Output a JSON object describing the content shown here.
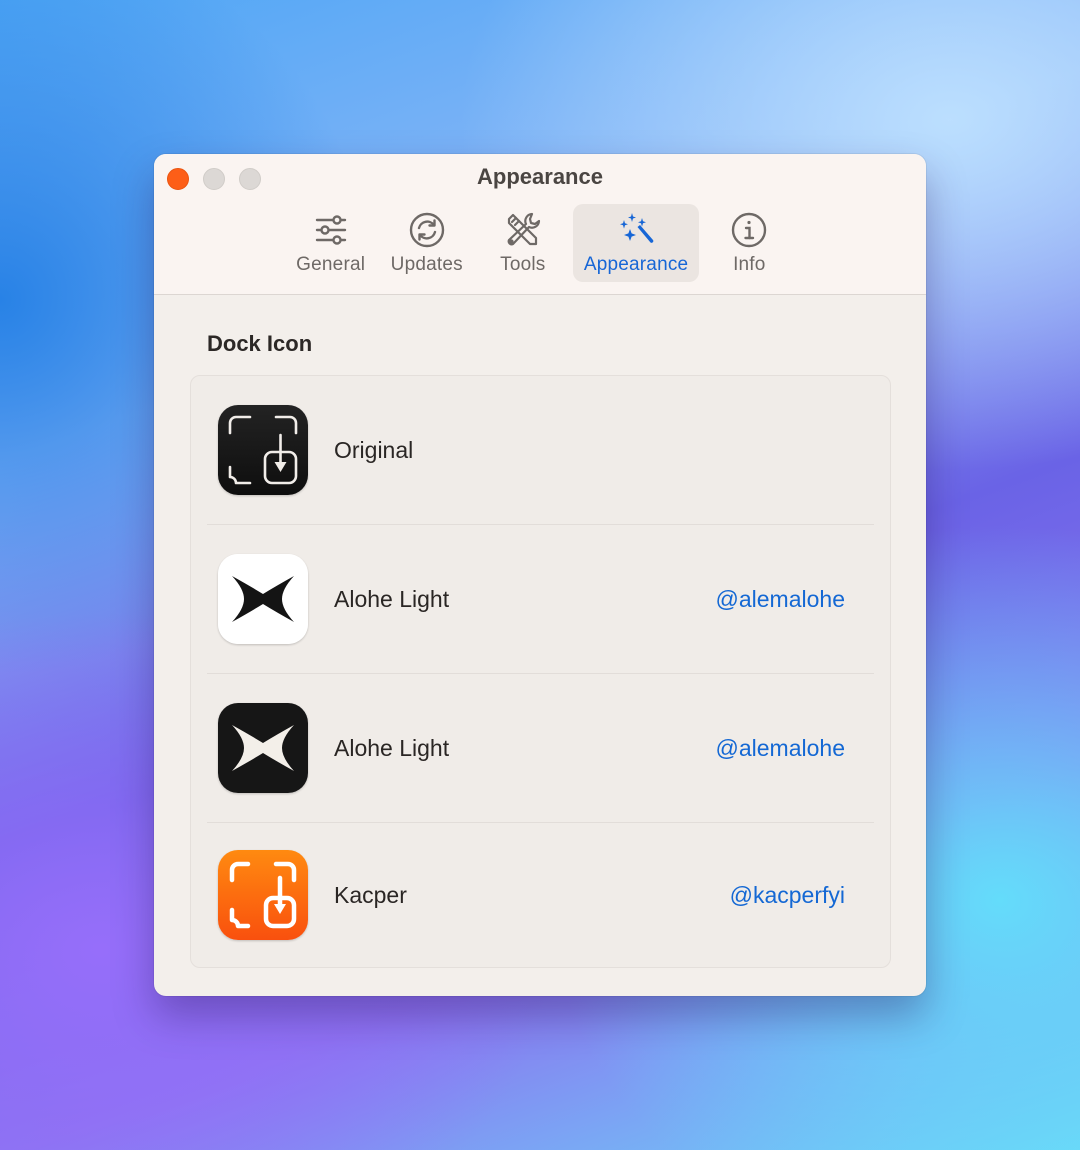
{
  "window": {
    "title": "Appearance",
    "traffic_lights": [
      "close",
      "minimize",
      "zoom"
    ]
  },
  "toolbar": {
    "tabs": [
      {
        "label": "General",
        "icon": "sliders-icon",
        "active": false
      },
      {
        "label": "Updates",
        "icon": "refresh-icon",
        "active": false
      },
      {
        "label": "Tools",
        "icon": "tools-icon",
        "active": false
      },
      {
        "label": "Appearance",
        "icon": "magic-wand-icon",
        "active": true
      },
      {
        "label": "Info",
        "icon": "info-icon",
        "active": false
      }
    ]
  },
  "dock_icon": {
    "section_title": "Dock Icon",
    "options": [
      {
        "name": "Original",
        "author": "",
        "icon": "original-dark-icon"
      },
      {
        "name": "Alohe Light",
        "author": "@alemalohe",
        "icon": "alohe-light-icon"
      },
      {
        "name": "Alohe Light",
        "author": "@alemalohe",
        "icon": "alohe-dark-icon"
      },
      {
        "name": "Kacper",
        "author": "@kacperfyi",
        "icon": "kacper-orange-icon"
      }
    ]
  },
  "colors": {
    "accent": "#1766d6",
    "close_button": "#fd5e17",
    "kacper_orange_top": "#ff8a10",
    "kacper_orange_bottom": "#f9500e"
  }
}
